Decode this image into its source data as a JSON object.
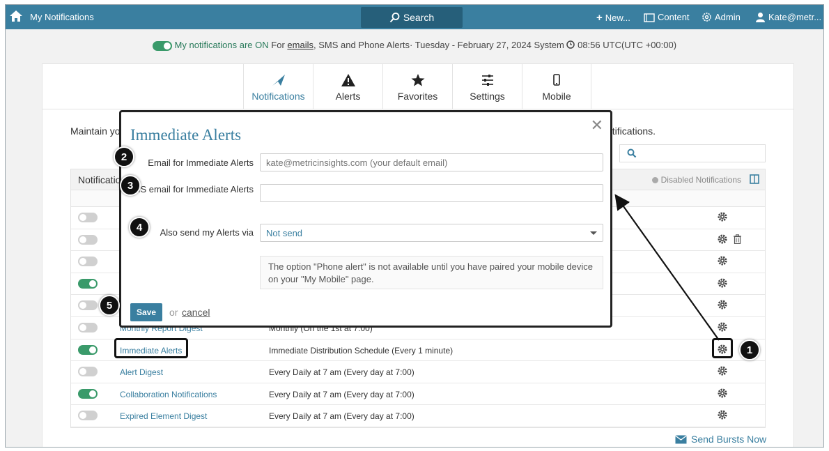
{
  "header": {
    "app_title": "My Notifications",
    "search_label": "Search",
    "new_label": "New...",
    "content_label": "Content",
    "admin_label": "Admin",
    "user_label": "Kate@metr..."
  },
  "status": {
    "on_text": "My notifications are ON",
    "for_text": "For",
    "emails_link": "emails",
    "rest_text": ", SMS and Phone Alerts· Tuesday - February 27, 2024 System",
    "time_text": "08:56 UTC(UTC +00:00)"
  },
  "tabs": [
    {
      "label": "Notifications",
      "icon": "paper-plane-icon"
    },
    {
      "label": "Alerts",
      "icon": "warning-icon"
    },
    {
      "label": "Favorites",
      "icon": "star-icon"
    },
    {
      "label": "Settings",
      "icon": "sliders-icon"
    },
    {
      "label": "Mobile",
      "icon": "mobile-icon"
    }
  ],
  "intro": {
    "start": "Maintain yo",
    "end": "otifications."
  },
  "table": {
    "first_header": "Notificatio",
    "disabled_label": "Disabled Notifications",
    "rows": [
      {
        "on": false,
        "name": "",
        "schedule": "",
        "trash": false
      },
      {
        "on": false,
        "name": "",
        "schedule": "",
        "trash": true
      },
      {
        "on": false,
        "name": "",
        "schedule": "",
        "trash": false
      },
      {
        "on": true,
        "name": "",
        "schedule": "",
        "trash": false
      },
      {
        "on": false,
        "name": "",
        "schedule": "",
        "trash": false
      },
      {
        "on": false,
        "name": "Monthly Report Digest",
        "schedule": "Monthly (On the 1st at 7:00)",
        "trash": false
      },
      {
        "on": true,
        "name": "Immediate Alerts",
        "schedule": "Immediate Distribution Schedule (Every 1 minute)",
        "trash": false
      },
      {
        "on": false,
        "name": "Alert Digest",
        "schedule": "Every Daily at 7 am (Every day at 7:00)",
        "trash": false
      },
      {
        "on": true,
        "name": "Collaboration Notifications",
        "schedule": "Every Daily at 7 am (Every day at 7:00)",
        "trash": false
      },
      {
        "on": false,
        "name": "Expired Element Digest",
        "schedule": "Every Daily at 7 am (Every day at 7:00)",
        "trash": false
      }
    ]
  },
  "send_now_label": "Send Bursts Now",
  "modal": {
    "title": "Immediate Alerts",
    "email_label": "Email for Immediate Alerts",
    "email_placeholder": "kate@metricinsights.com (your default email)",
    "sms_label": "SMS email for Immediate Alerts",
    "sms_value": "",
    "send_via_label": "Also send my Alerts via",
    "send_via_value": "Not send",
    "note": "The option \"Phone alert\" is not available until you have paired your mobile device on your \"My Mobile\" page.",
    "save_label": "Save",
    "or_label": "or",
    "cancel_label": "cancel"
  },
  "callouts": [
    "1",
    "2",
    "3",
    "4",
    "5"
  ],
  "colors": {
    "brand": "#3a7fa0",
    "toggle_on": "#3a9a6a",
    "toggle_off": "#d0d0d0"
  }
}
